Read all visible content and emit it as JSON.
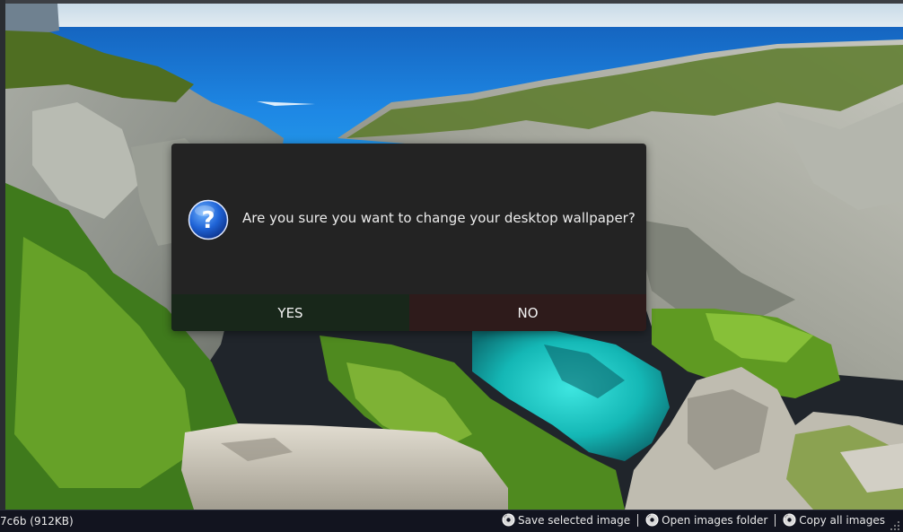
{
  "dialog": {
    "message": "Are you sure you want to change your desktop wallpaper?",
    "icon": "question-icon",
    "yes_label": "YES",
    "no_label": "NO",
    "yes_color": "#18271a",
    "no_color": "#2e1b1b"
  },
  "statusbar": {
    "file_info": "7c6b (912KB)",
    "actions": [
      {
        "label": "Save selected image",
        "icon": "save-disc-icon"
      },
      {
        "label": "Open images folder",
        "icon": "folder-disc-icon"
      },
      {
        "label": "Copy all images",
        "icon": "copy-disc-icon"
      }
    ]
  },
  "wallpaper": {
    "subject": "coastal limestone calanque with turquoise water"
  }
}
